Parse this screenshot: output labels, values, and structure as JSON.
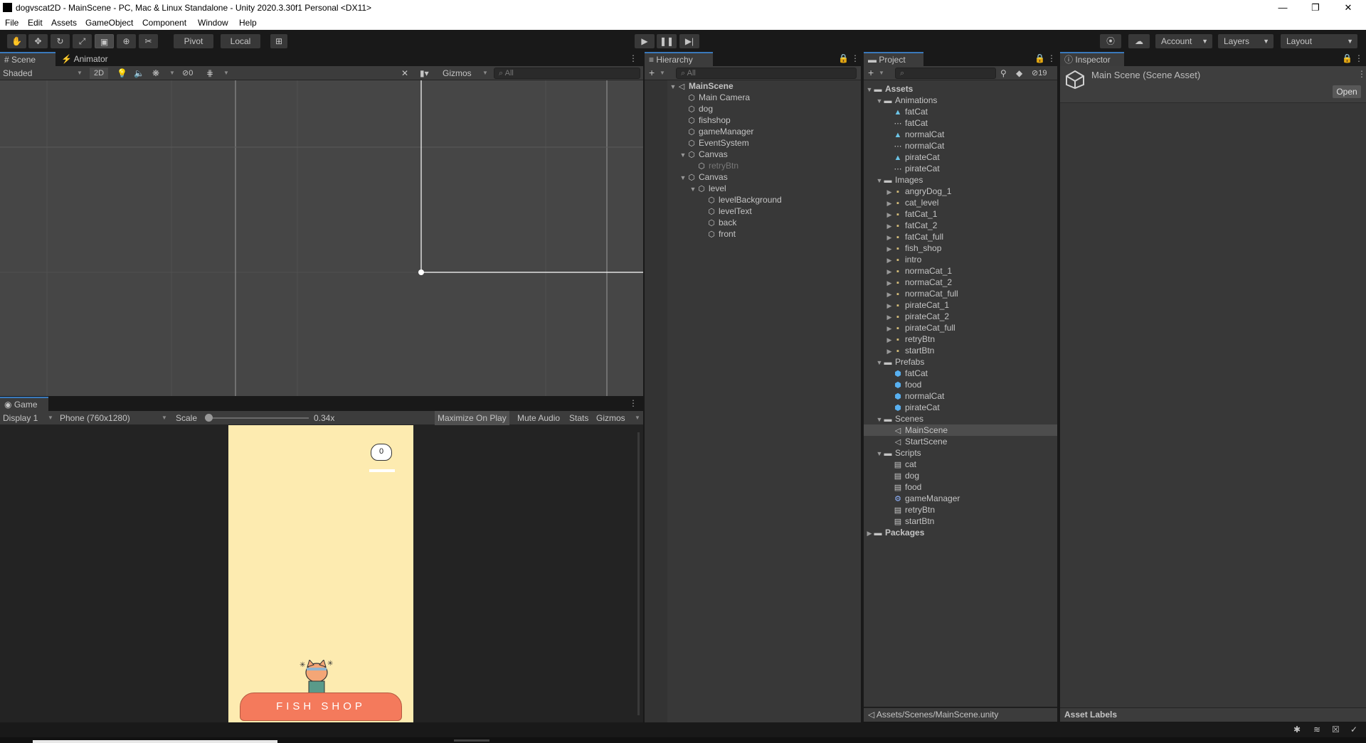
{
  "window": {
    "title": "dogvscat2D - MainScene - PC, Mac & Linux Standalone - Unity 2020.3.30f1 Personal <DX11>",
    "minimize": "—",
    "maximize": "❐",
    "close": "✕"
  },
  "menu": [
    "File",
    "Edit",
    "Assets",
    "GameObject",
    "Component",
    "Window",
    "Help"
  ],
  "toolbar": {
    "pivot": "Pivot",
    "local": "Local",
    "account": "Account",
    "layers": "Layers",
    "layout": "Layout"
  },
  "scene_panel": {
    "tabs": [
      "Scene",
      "Animator"
    ],
    "shading": "Shaded",
    "mode_2d": "2D",
    "hidden_count": "0",
    "gizmos": "Gizmos",
    "search_placeholder": "All"
  },
  "game_panel": {
    "tab": "Game",
    "display": "Display 1",
    "resolution": "Phone (760x1280)",
    "scale_label": "Scale",
    "scale_value": "0.34x",
    "scale_fraction": 0.0,
    "maximize": "Maximize On Play",
    "mute": "Mute Audio",
    "stats": "Stats",
    "gizmos": "Gizmos",
    "score": "0",
    "shop_text": "FISH SHOP"
  },
  "hierarchy": {
    "tab": "Hierarchy",
    "search_placeholder": "All",
    "items": [
      {
        "label": "MainScene",
        "depth": 0,
        "icon": "unity-scene-icon",
        "expanded": true,
        "bold": true
      },
      {
        "label": "Main Camera",
        "depth": 1,
        "icon": "gameobject-cube-icon"
      },
      {
        "label": "dog",
        "depth": 1,
        "icon": "gameobject-cube-icon"
      },
      {
        "label": "fishshop",
        "depth": 1,
        "icon": "gameobject-cube-icon"
      },
      {
        "label": "gameManager",
        "depth": 1,
        "icon": "gameobject-cube-icon"
      },
      {
        "label": "EventSystem",
        "depth": 1,
        "icon": "gameobject-cube-icon"
      },
      {
        "label": "Canvas",
        "depth": 1,
        "icon": "gameobject-cube-icon",
        "expanded": true
      },
      {
        "label": "retryBtn",
        "depth": 2,
        "icon": "gameobject-cube-icon",
        "disabled": true
      },
      {
        "label": "Canvas",
        "depth": 1,
        "icon": "gameobject-cube-icon",
        "expanded": true
      },
      {
        "label": "level",
        "depth": 2,
        "icon": "gameobject-cube-icon",
        "expanded": true
      },
      {
        "label": "levelBackground",
        "depth": 3,
        "icon": "gameobject-cube-icon"
      },
      {
        "label": "levelText",
        "depth": 3,
        "icon": "gameobject-cube-icon"
      },
      {
        "label": "back",
        "depth": 3,
        "icon": "gameobject-cube-icon"
      },
      {
        "label": "front",
        "depth": 3,
        "icon": "gameobject-cube-icon"
      }
    ]
  },
  "project": {
    "tab": "Project",
    "hidden_count": "19",
    "path": "Assets/Scenes/MainScene.unity",
    "items": [
      {
        "label": "Assets",
        "depth": 0,
        "icon": "folder-icon",
        "expanded": true,
        "bold": true
      },
      {
        "label": "Animations",
        "depth": 1,
        "icon": "folder-icon",
        "expanded": true
      },
      {
        "label": "fatCat",
        "depth": 2,
        "icon": "animation-clip-icon"
      },
      {
        "label": "fatCat",
        "depth": 2,
        "icon": "animator-controller-icon"
      },
      {
        "label": "normalCat",
        "depth": 2,
        "icon": "animation-clip-icon"
      },
      {
        "label": "normalCat",
        "depth": 2,
        "icon": "animator-controller-icon"
      },
      {
        "label": "pirateCat",
        "depth": 2,
        "icon": "animation-clip-icon"
      },
      {
        "label": "pirateCat",
        "depth": 2,
        "icon": "animator-controller-icon"
      },
      {
        "label": "Images",
        "depth": 1,
        "icon": "folder-icon",
        "expanded": true
      },
      {
        "label": "angryDog_1",
        "depth": 2,
        "icon": "sprite-icon",
        "collapsed": true
      },
      {
        "label": "cat_level",
        "depth": 2,
        "icon": "sprite-icon",
        "collapsed": true
      },
      {
        "label": "fatCat_1",
        "depth": 2,
        "icon": "sprite-icon",
        "collapsed": true
      },
      {
        "label": "fatCat_2",
        "depth": 2,
        "icon": "sprite-icon",
        "collapsed": true
      },
      {
        "label": "fatCat_full",
        "depth": 2,
        "icon": "sprite-icon",
        "collapsed": true
      },
      {
        "label": "fish_shop",
        "depth": 2,
        "icon": "sprite-icon",
        "collapsed": true
      },
      {
        "label": "intro",
        "depth": 2,
        "icon": "sprite-icon",
        "collapsed": true
      },
      {
        "label": "normaCat_1",
        "depth": 2,
        "icon": "sprite-icon",
        "collapsed": true
      },
      {
        "label": "normaCat_2",
        "depth": 2,
        "icon": "sprite-icon",
        "collapsed": true
      },
      {
        "label": "normaCat_full",
        "depth": 2,
        "icon": "sprite-icon",
        "collapsed": true
      },
      {
        "label": "pirateCat_1",
        "depth": 2,
        "icon": "sprite-icon",
        "collapsed": true
      },
      {
        "label": "pirateCat_2",
        "depth": 2,
        "icon": "sprite-icon",
        "collapsed": true
      },
      {
        "label": "pirateCat_full",
        "depth": 2,
        "icon": "sprite-icon",
        "collapsed": true
      },
      {
        "label": "retryBtn",
        "depth": 2,
        "icon": "sprite-icon",
        "collapsed": true
      },
      {
        "label": "startBtn",
        "depth": 2,
        "icon": "sprite-icon",
        "collapsed": true
      },
      {
        "label": "Prefabs",
        "depth": 1,
        "icon": "folder-icon",
        "expanded": true
      },
      {
        "label": "fatCat",
        "depth": 2,
        "icon": "prefab-icon"
      },
      {
        "label": "food",
        "depth": 2,
        "icon": "prefab-icon"
      },
      {
        "label": "normalCat",
        "depth": 2,
        "icon": "prefab-icon"
      },
      {
        "label": "pirateCat",
        "depth": 2,
        "icon": "prefab-icon"
      },
      {
        "label": "Scenes",
        "depth": 1,
        "icon": "folder-icon",
        "expanded": true
      },
      {
        "label": "MainScene",
        "depth": 2,
        "icon": "unity-scene-icon",
        "selected": true
      },
      {
        "label": "StartScene",
        "depth": 2,
        "icon": "unity-scene-icon"
      },
      {
        "label": "Scripts",
        "depth": 1,
        "icon": "folder-icon",
        "expanded": true
      },
      {
        "label": "cat",
        "depth": 2,
        "icon": "csharp-script-icon"
      },
      {
        "label": "dog",
        "depth": 2,
        "icon": "csharp-script-icon"
      },
      {
        "label": "food",
        "depth": 2,
        "icon": "csharp-script-icon"
      },
      {
        "label": "gameManager",
        "depth": 2,
        "icon": "gear-script-icon"
      },
      {
        "label": "retryBtn",
        "depth": 2,
        "icon": "csharp-script-icon"
      },
      {
        "label": "startBtn",
        "depth": 2,
        "icon": "csharp-script-icon"
      },
      {
        "label": "Packages",
        "depth": 0,
        "icon": "folder-icon",
        "collapsed": true,
        "bold": true
      }
    ]
  },
  "inspector": {
    "tab": "Inspector",
    "asset_title": "Main Scene (Scene Asset)",
    "open_button": "Open",
    "asset_labels": "Asset Labels"
  }
}
